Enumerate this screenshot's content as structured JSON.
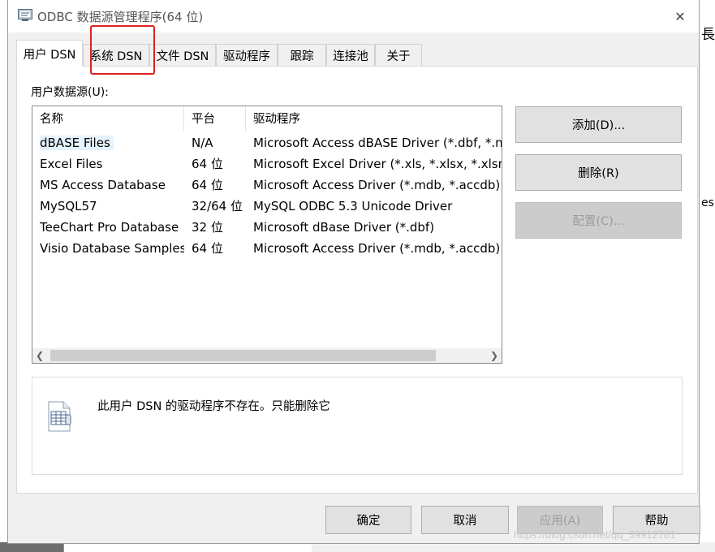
{
  "window": {
    "title": "ODBC 数据源管理程序(64 位)",
    "close_glyph": "✕"
  },
  "tabs": [
    {
      "label": "用户 DSN",
      "active": true
    },
    {
      "label": "系统 DSN",
      "active": false
    },
    {
      "label": "文件 DSN",
      "active": false
    },
    {
      "label": "驱动程序",
      "active": false
    },
    {
      "label": "跟踪",
      "active": false
    },
    {
      "label": "连接池",
      "active": false
    },
    {
      "label": "关于",
      "active": false
    }
  ],
  "panel": {
    "section_label": "用户数据源(U):",
    "columns": [
      "名称",
      "平台",
      "驱动程序"
    ],
    "rows": [
      {
        "name": "dBASE Files",
        "platform": "N/A",
        "driver": "Microsoft Access dBASE Driver (*.dbf, *.nd"
      },
      {
        "name": "Excel Files",
        "platform": "64 位",
        "driver": "Microsoft Excel Driver (*.xls, *.xlsx, *.xlsm, *"
      },
      {
        "name": "MS Access Database",
        "platform": "64 位",
        "driver": "Microsoft Access Driver (*.mdb, *.accdb)"
      },
      {
        "name": "MySQL57",
        "platform": "32/64 位",
        "driver": "MySQL ODBC 5.3 Unicode Driver"
      },
      {
        "name": "TeeChart Pro Database",
        "platform": "32 位",
        "driver": "Microsoft dBase Driver (*.dbf)"
      },
      {
        "name": "Visio Database Samples",
        "platform": "64 位",
        "driver": "Microsoft Access Driver (*.mdb, *.accdb)"
      }
    ],
    "selected_row": "dBASE Files",
    "buttons": {
      "add": "添加(D)...",
      "remove": "删除(R)",
      "configure": "配置(C)..."
    },
    "info_text": "此用户 DSN 的驱动程序不存在。只能删除它"
  },
  "footer_buttons": {
    "ok": "确定",
    "cancel": "取消",
    "apply": "应用(A)",
    "help": "帮助"
  },
  "background": {
    "fragment_top": "長",
    "fragment_mid": "es"
  },
  "watermark": "https://blog.csdn.net/qq_39912781",
  "colors": {
    "highlight_box": "#e02020",
    "selection": "#e5f3ff",
    "dialog_bg": "#f0f0f0"
  }
}
